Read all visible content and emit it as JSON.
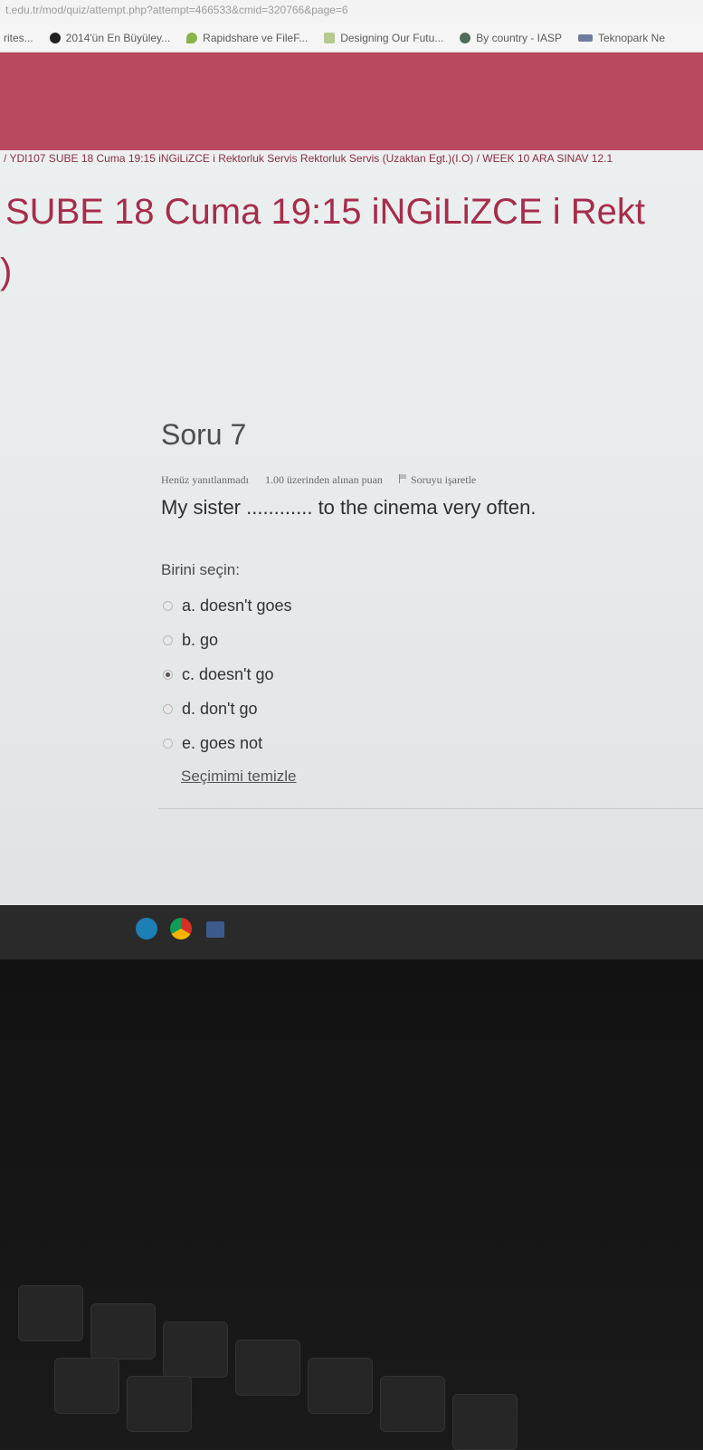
{
  "browser": {
    "url": "t.edu.tr/mod/quiz/attempt.php?attempt=466533&cmid=320766&page=6",
    "bookmarks": [
      {
        "label": "rites...",
        "icon": "none"
      },
      {
        "label": "2014'ün En Büyüley...",
        "icon": "circle-icon"
      },
      {
        "label": "Rapidshare ve FileF...",
        "icon": "drop-icon"
      },
      {
        "label": "Designing Our Futu...",
        "icon": "page-icon"
      },
      {
        "label": "By country - IASP",
        "icon": "globe-icon"
      },
      {
        "label": "Teknopark Ne",
        "icon": "logo-icon"
      }
    ]
  },
  "page": {
    "breadcrumb": "/  YDI107 SUBE 18 Cuma 19:15 iNGiLiZCE i Rektorluk Servis Rektorluk Servis (Uzaktan Egt.)(I.O)   /   WEEK 10 ARA SINAV 12.1",
    "course_title": "SUBE 18 Cuma 19:15 iNGiLiZCE i Rekt",
    "course_title_cont": ")"
  },
  "question": {
    "title": "Soru 7",
    "status": "Henüz yanıtlanmadı",
    "points": "1.00 üzerinden alınan puan",
    "flag_label": "Soruyu işaretle",
    "text": "My sister ............ to the cinema very often.",
    "prompt": "Birini seçin:",
    "options": [
      {
        "label": "a. doesn't goes",
        "checked": false
      },
      {
        "label": "b. go",
        "checked": false
      },
      {
        "label": "c. doesn't go",
        "checked": true
      },
      {
        "label": "d. don't go",
        "checked": false
      },
      {
        "label": "e. goes not",
        "checked": false
      }
    ],
    "clear_label": "Seçimimi temizle"
  },
  "colors": {
    "banner": "#b8495e",
    "title": "#a62d4b"
  }
}
